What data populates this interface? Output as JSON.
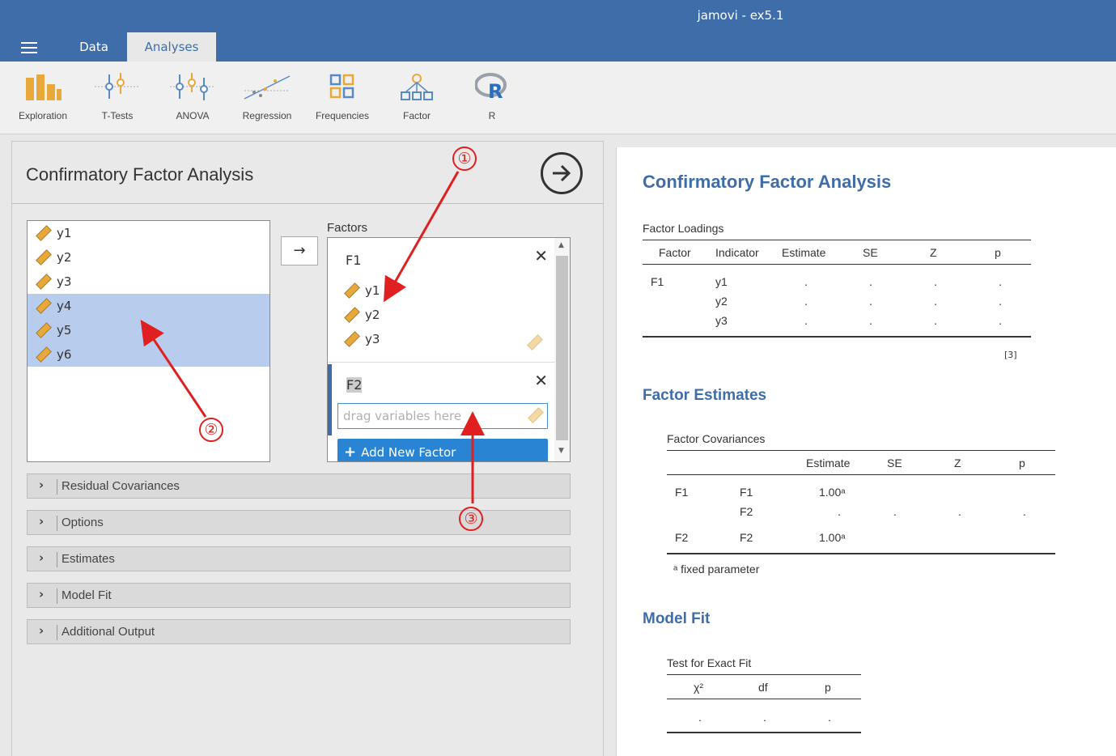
{
  "window": {
    "title": "jamovi - ex5.1"
  },
  "tabs": [
    {
      "label": "Data"
    },
    {
      "label": "Analyses"
    }
  ],
  "ribbon": [
    {
      "label": "Exploration",
      "icon": "exploration-icon"
    },
    {
      "label": "T-Tests",
      "icon": "ttests-icon"
    },
    {
      "label": "ANOVA",
      "icon": "anova-icon"
    },
    {
      "label": "Regression",
      "icon": "regression-icon"
    },
    {
      "label": "Frequencies",
      "icon": "frequencies-icon"
    },
    {
      "label": "Factor",
      "icon": "factor-icon"
    },
    {
      "label": "R",
      "icon": "r-icon"
    }
  ],
  "options": {
    "title": "Confirmatory Factor Analysis",
    "variables": [
      {
        "name": "y1",
        "selected": false
      },
      {
        "name": "y2",
        "selected": false
      },
      {
        "name": "y3",
        "selected": false
      },
      {
        "name": "y4",
        "selected": true
      },
      {
        "name": "y5",
        "selected": true
      },
      {
        "name": "y6",
        "selected": true
      }
    ],
    "move_button": "→",
    "factors_label": "Factors",
    "factors": [
      {
        "name": "F1",
        "vars": [
          "y1",
          "y2",
          "y3"
        ]
      },
      {
        "name": "F2",
        "placeholder": "drag variables here"
      }
    ],
    "add_factor": "Add New Factor",
    "sections": [
      "Residual Covariances",
      "Options",
      "Estimates",
      "Model Fit",
      "Additional Output"
    ]
  },
  "results": {
    "title": "Confirmatory Factor Analysis",
    "loadings": {
      "title": "Factor Loadings",
      "headers": [
        "Factor",
        "Indicator",
        "Estimate",
        "SE",
        "Z",
        "p"
      ],
      "rows": [
        {
          "factor": "F1",
          "indicator": "y1",
          "estimate": ".",
          "se": ".",
          "z": ".",
          "p": "."
        },
        {
          "factor": "",
          "indicator": "y2",
          "estimate": ".",
          "se": ".",
          "z": ".",
          "p": "."
        },
        {
          "factor": "",
          "indicator": "y3",
          "estimate": ".",
          "se": ".",
          "z": ".",
          "p": "."
        }
      ],
      "ref": "[3]"
    },
    "factor_estimates": {
      "heading": "Factor Estimates",
      "title": "Factor Covariances",
      "headers": [
        "",
        "",
        "Estimate",
        "SE",
        "Z",
        "p"
      ],
      "rows": [
        {
          "a": "F1",
          "b": "F1",
          "estimate": "1.00ᵃ",
          "se": "",
          "z": "",
          "p": ""
        },
        {
          "a": "",
          "b": "F2",
          "estimate": ".",
          "se": ".",
          "z": ".",
          "p": "."
        },
        {
          "a": "F2",
          "b": "F2",
          "estimate": "1.00ᵃ",
          "se": "",
          "z": "",
          "p": ""
        }
      ],
      "footnote": "ᵃ fixed parameter"
    },
    "model_fit": {
      "heading": "Model Fit",
      "title": "Test for Exact Fit",
      "headers": [
        "χ²",
        "df",
        "p"
      ],
      "row": [
        ".",
        ".",
        "."
      ]
    }
  },
  "annotations": [
    "①",
    "②",
    "③"
  ],
  "colors": {
    "brand": "#3e6da9",
    "selection": "#b8cdee",
    "accent_button": "#2a84d4",
    "annotation": "#e02020",
    "variable_icon": "#e8a93a"
  }
}
